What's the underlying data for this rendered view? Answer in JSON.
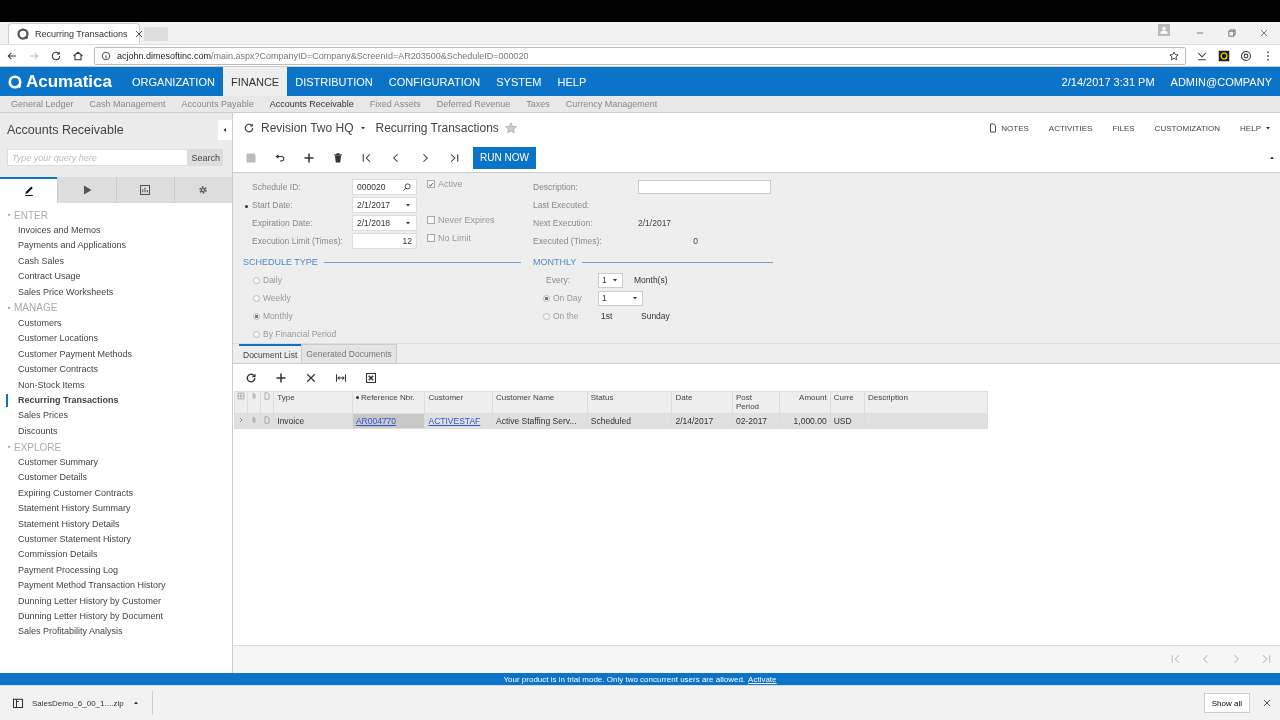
{
  "browser": {
    "tab_title": "Recurring Transactions",
    "url_host": "acjohn.dimesoftinc.com",
    "url_path": "/main.aspx?CompanyID=Company&ScreenId=AR203500&ScheduleID=000020"
  },
  "nav": {
    "logo": "Acumatica",
    "menus": [
      {
        "label": "ORGANIZATION",
        "selected": false
      },
      {
        "label": "FINANCE",
        "selected": true
      },
      {
        "label": "DISTRIBUTION",
        "selected": false
      },
      {
        "label": "CONFIGURATION",
        "selected": false
      },
      {
        "label": "SYSTEM",
        "selected": false
      },
      {
        "label": "HELP",
        "selected": false
      }
    ],
    "datetime": "2/14/2017  3:31 PM",
    "user": "ADMIN@COMPANY"
  },
  "subnav": [
    {
      "label": "General Ledger",
      "selected": false
    },
    {
      "label": "Cash Management",
      "selected": false
    },
    {
      "label": "Accounts Payable",
      "selected": false
    },
    {
      "label": "Accounts Receivable",
      "selected": true
    },
    {
      "label": "Fixed Assets",
      "selected": false
    },
    {
      "label": "Deferred Revenue",
      "selected": false
    },
    {
      "label": "Taxes",
      "selected": false
    },
    {
      "label": "Currency Management",
      "selected": false
    }
  ],
  "sidebar": {
    "title": "Accounts Receivable",
    "search": {
      "placeholder": "Type your query here",
      "button": "Search"
    },
    "tabs": [
      {
        "kind": "edit",
        "selected": true
      },
      {
        "kind": "process",
        "selected": false
      },
      {
        "kind": "reports",
        "selected": false
      },
      {
        "kind": "settings",
        "selected": false
      }
    ],
    "sections": [
      {
        "label": "ENTER",
        "expanded": true,
        "items": [
          {
            "label": "Invoices and Memos",
            "selected": false
          },
          {
            "label": "Payments and Applications",
            "selected": false
          },
          {
            "label": "Cash Sales",
            "selected": false
          },
          {
            "label": "Contract Usage",
            "selected": false
          },
          {
            "label": "Sales Price Worksheets",
            "selected": false
          }
        ]
      },
      {
        "label": "MANAGE",
        "expanded": true,
        "items": [
          {
            "label": "Customers",
            "selected": false
          },
          {
            "label": "Customer Locations",
            "selected": false
          },
          {
            "label": "Customer Payment Methods",
            "selected": false
          },
          {
            "label": "Customer Contracts",
            "selected": false
          },
          {
            "label": "Non-Stock Items",
            "selected": false
          },
          {
            "label": "Recurring Transactions",
            "selected": true
          },
          {
            "label": "Sales Prices",
            "selected": false
          },
          {
            "label": "Discounts",
            "selected": false
          }
        ]
      },
      {
        "label": "EXPLORE",
        "expanded": true,
        "items": [
          {
            "label": "Customer Summary",
            "selected": false
          },
          {
            "label": "Customer Details",
            "selected": false
          },
          {
            "label": "Expiring Customer Contracts",
            "selected": false
          },
          {
            "label": "Statement History Summary",
            "selected": false
          },
          {
            "label": "Statement History Details",
            "selected": false
          },
          {
            "label": "Customer Statement History",
            "selected": false
          },
          {
            "label": "Commission Details",
            "selected": false
          },
          {
            "label": "Payment Processing Log",
            "selected": false
          },
          {
            "label": "Payment Method Transaction History",
            "selected": false
          },
          {
            "label": "Dunning Letter History by Customer",
            "selected": false
          },
          {
            "label": "Dunning Letter History by Document",
            "selected": false
          },
          {
            "label": "Sales Profitability Analysis",
            "selected": false
          }
        ]
      }
    ]
  },
  "page": {
    "company": "Revision Two HQ",
    "title": "Recurring Transactions",
    "favorite": false,
    "links": [
      {
        "label": "NOTES",
        "kind": "notes"
      },
      {
        "label": "ACTIVITIES",
        "kind": "plain"
      },
      {
        "label": "FILES",
        "kind": "plain"
      },
      {
        "label": "CUSTOMIZATION",
        "kind": "plain"
      },
      {
        "label": "HELP",
        "kind": "menu"
      }
    ]
  },
  "toolbar": {
    "buttons": [
      {
        "kind": "save",
        "disabled": true
      },
      {
        "kind": "undo",
        "disabled": false
      },
      {
        "kind": "add",
        "disabled": false
      },
      {
        "kind": "delete",
        "disabled": false
      },
      {
        "kind": "first",
        "disabled": false
      },
      {
        "kind": "prev",
        "disabled": false
      },
      {
        "kind": "next",
        "disabled": false
      },
      {
        "kind": "last",
        "disabled": false
      }
    ],
    "run": "RUN NOW"
  },
  "form": {
    "left": [
      {
        "label": "Schedule ID:",
        "value": "000020",
        "kind": "lookup",
        "required": false,
        "check": {
          "label": "Active",
          "checked": true
        }
      },
      {
        "label": "Start Date:",
        "value": "2/1/2017",
        "kind": "date",
        "required": true
      },
      {
        "label": "Expiration Date:",
        "value": "2/1/2018",
        "kind": "date",
        "required": false,
        "check": {
          "label": "Never Expires",
          "checked": false
        }
      },
      {
        "label": "Execution Limit (Times):",
        "value": "12",
        "kind": "number",
        "required": false,
        "check": {
          "label": "No Limit",
          "checked": false
        }
      }
    ],
    "right": [
      {
        "label": "Description:",
        "kind": "input"
      },
      {
        "label": "Last Executed:",
        "kind": "readonly"
      },
      {
        "label": "Next Execution:",
        "value": "2/1/2017",
        "kind": "readonly"
      },
      {
        "label": "Executed (Times):",
        "value": "0",
        "kind": "number"
      }
    ],
    "schedule_type": {
      "title": "SCHEDULE TYPE",
      "options": [
        {
          "label": "Daily",
          "selected": false
        },
        {
          "label": "Weekly",
          "selected": false
        },
        {
          "label": "Monthly",
          "selected": true
        },
        {
          "label": "By Financial Period",
          "selected": false
        }
      ]
    },
    "monthly": {
      "title": "MONTHLY",
      "every": {
        "label": "Every:",
        "value": "1",
        "unit": "Month(s)"
      },
      "on_day": {
        "label": "On Day",
        "selected": true,
        "value": "1"
      },
      "on_the": {
        "label": "On the",
        "selected": false,
        "week": "1st",
        "day": "Sunday"
      }
    }
  },
  "doc_tabs": [
    {
      "label": "Document List",
      "selected": true
    },
    {
      "label": "Generated Documents",
      "selected": false
    }
  ],
  "grid_toolbar": [
    {
      "kind": "refresh"
    },
    {
      "kind": "add"
    },
    {
      "kind": "remove"
    },
    {
      "kind": "fit"
    },
    {
      "kind": "excel"
    }
  ],
  "table": {
    "columns": [
      {
        "label": "Type",
        "required": false
      },
      {
        "label": "Reference Nbr.",
        "required": true
      },
      {
        "label": "Customer",
        "required": false
      },
      {
        "label": "Customer Name",
        "required": false
      },
      {
        "label": "Status",
        "required": false
      },
      {
        "label": "Date",
        "required": false
      },
      {
        "label": "Post Period",
        "required": false
      },
      {
        "label": "Amount",
        "required": false
      },
      {
        "label": "Curre",
        "required": false
      },
      {
        "label": "Description",
        "required": false
      }
    ],
    "rows": [
      {
        "selected": true,
        "cells": [
          {
            "text": "Invoice",
            "kind": "text"
          },
          {
            "text": "AR004770",
            "kind": "link"
          },
          {
            "text": "ACTIVESTAF",
            "kind": "link"
          },
          {
            "text": "Active Staffing Serv...",
            "kind": "text"
          },
          {
            "text": "Scheduled",
            "kind": "text"
          },
          {
            "text": "2/14/2017",
            "kind": "text"
          },
          {
            "text": "02-2017",
            "kind": "text"
          },
          {
            "text": "1,000.00",
            "kind": "number"
          },
          {
            "text": "USD",
            "kind": "text"
          }
        ]
      }
    ]
  },
  "trial": {
    "text": "Your product is in trial mode. Only two concurrent users are allowed.",
    "link": "Activate"
  },
  "downloads": {
    "file": "SalesDemo_6_00_1....zip",
    "show_all": "Show all"
  }
}
